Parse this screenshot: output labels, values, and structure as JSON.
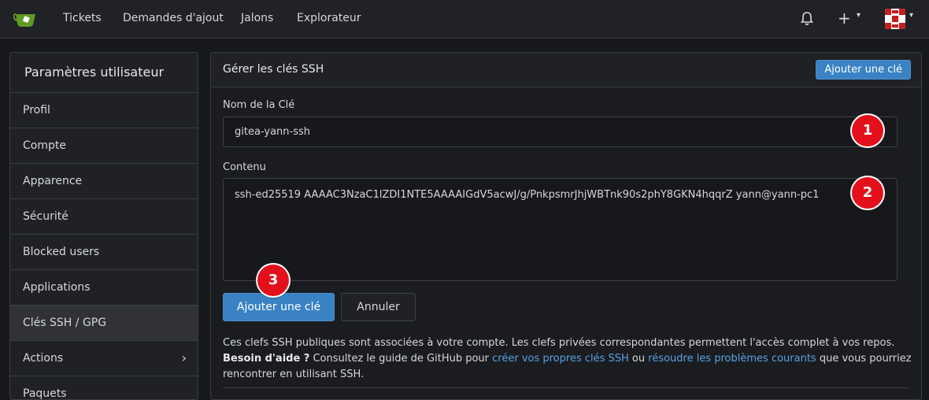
{
  "nav": {
    "items": [
      "Tickets",
      "Demandes d'ajout",
      "Jalons",
      "Explorateur"
    ],
    "plus_icon": "+",
    "caret_icon": "▾"
  },
  "sidebar": {
    "title": "Paramètres utilisateur",
    "items": [
      {
        "label": "Profil"
      },
      {
        "label": "Compte"
      },
      {
        "label": "Apparence"
      },
      {
        "label": "Sécurité"
      },
      {
        "label": "Blocked users"
      },
      {
        "label": "Applications"
      },
      {
        "label": "Clés SSH / GPG"
      },
      {
        "label": "Actions"
      },
      {
        "label": "Paquets"
      }
    ],
    "chevron": "›"
  },
  "panel": {
    "title": "Gérer les clés SSH",
    "add_key_label": "Ajouter une clé",
    "key_name_label": "Nom de la Clé",
    "key_name_value": "gitea-yann-ssh",
    "content_label": "Contenu",
    "content_value": "ssh-ed25519 AAAAC3NzaC1lZDI1NTE5AAAAIGdV5acwJ/g/PnkpsmrJhjWBTnk90s2phY8GKN4hqqrZ yann@yann-pc1",
    "submit_label": "Ajouter une clé",
    "cancel_label": "Annuler",
    "help": {
      "text1": "Ces clefs SSH publiques sont associées à votre compte. Les clefs privées correspondantes permettent l'accès complet à vos repos.",
      "bold": "Besoin d'aide ?",
      "text2": " Consultez le guide de GitHub pour ",
      "link1": "créer vos propres clés SSH",
      "text3": " ou ",
      "link2": "résoudre les problèmes courants",
      "text4": " que vous pourriez rencontrer en utilisant SSH."
    }
  },
  "badges": [
    "1",
    "2",
    "3"
  ],
  "colors": {
    "primary": "#3a82c4",
    "badge": "#e3101b",
    "link": "#5aa1e3",
    "logo": "#609926"
  }
}
